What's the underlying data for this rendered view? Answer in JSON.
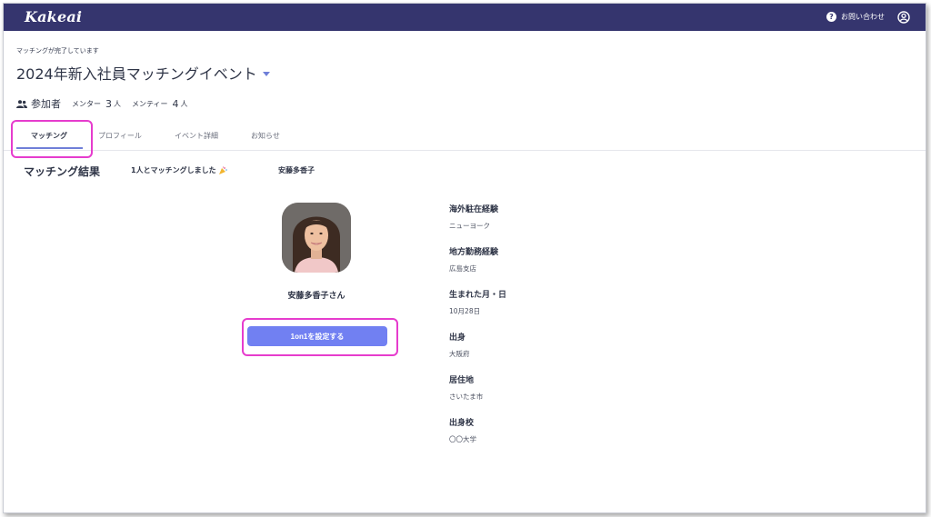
{
  "app": {
    "logo": "Kakeai",
    "help_label": "お問い合わせ",
    "help_icon": "question-circle-icon",
    "user_icon": "user-circle-icon"
  },
  "event": {
    "status": "マッチングが完了しています",
    "title": "2024年新入社員マッチングイベント",
    "participants_label": "参加者",
    "mentor_label": "メンター",
    "mentor_count": "3",
    "mentee_label": "メンティー",
    "mentee_count": "4",
    "unit": "人"
  },
  "tabs": [
    {
      "label": "マッチング",
      "active": true
    },
    {
      "label": "プロフィール",
      "active": false
    },
    {
      "label": "イベント詳細",
      "active": false
    },
    {
      "label": "お知らせ",
      "active": false
    }
  ],
  "result": {
    "section_title": "マッチング結果",
    "match_count_text": "1人とマッチングしました",
    "matched_name": "安藤多香子",
    "person_display_name": "安藤多香子さん",
    "button_label": "1on1を設定する"
  },
  "profile": [
    {
      "label": "海外駐在経験",
      "value": "ニューヨーク"
    },
    {
      "label": "地方勤務経験",
      "value": "広島支店"
    },
    {
      "label": "生まれた月・日",
      "value": "10月28日"
    },
    {
      "label": "出身",
      "value": "大阪府"
    },
    {
      "label": "居住地",
      "value": "さいたま市"
    },
    {
      "label": "出身校",
      "value": "〇〇大学"
    }
  ],
  "colors": {
    "header": "#35356e",
    "accent": "#7180f2",
    "highlight": "#e63ccd"
  }
}
